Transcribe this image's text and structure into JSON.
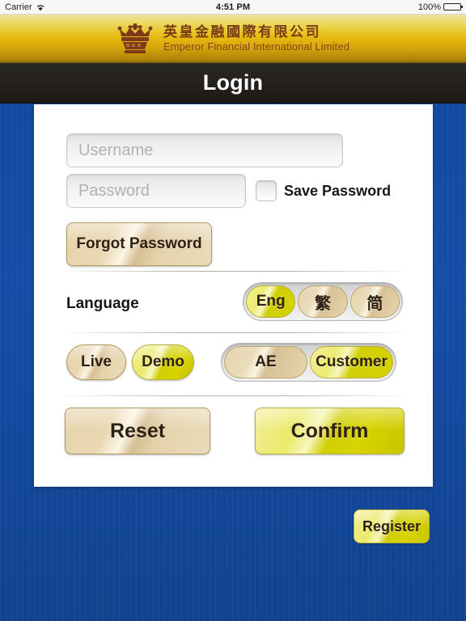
{
  "status_bar": {
    "carrier": "Carrier",
    "wifi_icon": "wifi-icon",
    "time": "4:51 PM",
    "battery_percent": "100%",
    "battery_icon": "battery-icon"
  },
  "banner": {
    "logo_icon": "crown-icon",
    "company_name_cn": "英皇金融國際有限公司",
    "company_name_en": "Emperor Financial International Limited"
  },
  "title_bar": {
    "title": "Login"
  },
  "form": {
    "username": {
      "placeholder": "Username",
      "value": ""
    },
    "password": {
      "placeholder": "Password",
      "value": ""
    },
    "save_password": {
      "label": "Save Password",
      "checked": false
    },
    "forgot_password_label": "Forgot Password",
    "language": {
      "label": "Language",
      "options": [
        {
          "label": "Eng",
          "selected": true
        },
        {
          "label": "繁",
          "selected": false
        },
        {
          "label": "简",
          "selected": false
        }
      ]
    },
    "account_mode": {
      "options": [
        {
          "label": "Live",
          "selected": false
        },
        {
          "label": "Demo",
          "selected": true
        }
      ]
    },
    "user_role": {
      "options": [
        {
          "label": "AE",
          "selected": false
        },
        {
          "label": "Customer",
          "selected": true
        }
      ]
    },
    "reset_label": "Reset",
    "confirm_label": "Confirm"
  },
  "footer": {
    "register_label": "Register"
  },
  "colors": {
    "background_blue": "#11479c",
    "banner_gold": "#e7bc12",
    "title_bar_dark": "#221f1c",
    "selected_yellow": "#d8d400",
    "unselected_tan": "#e6d4ad",
    "brand_brown": "#7a3c12"
  }
}
